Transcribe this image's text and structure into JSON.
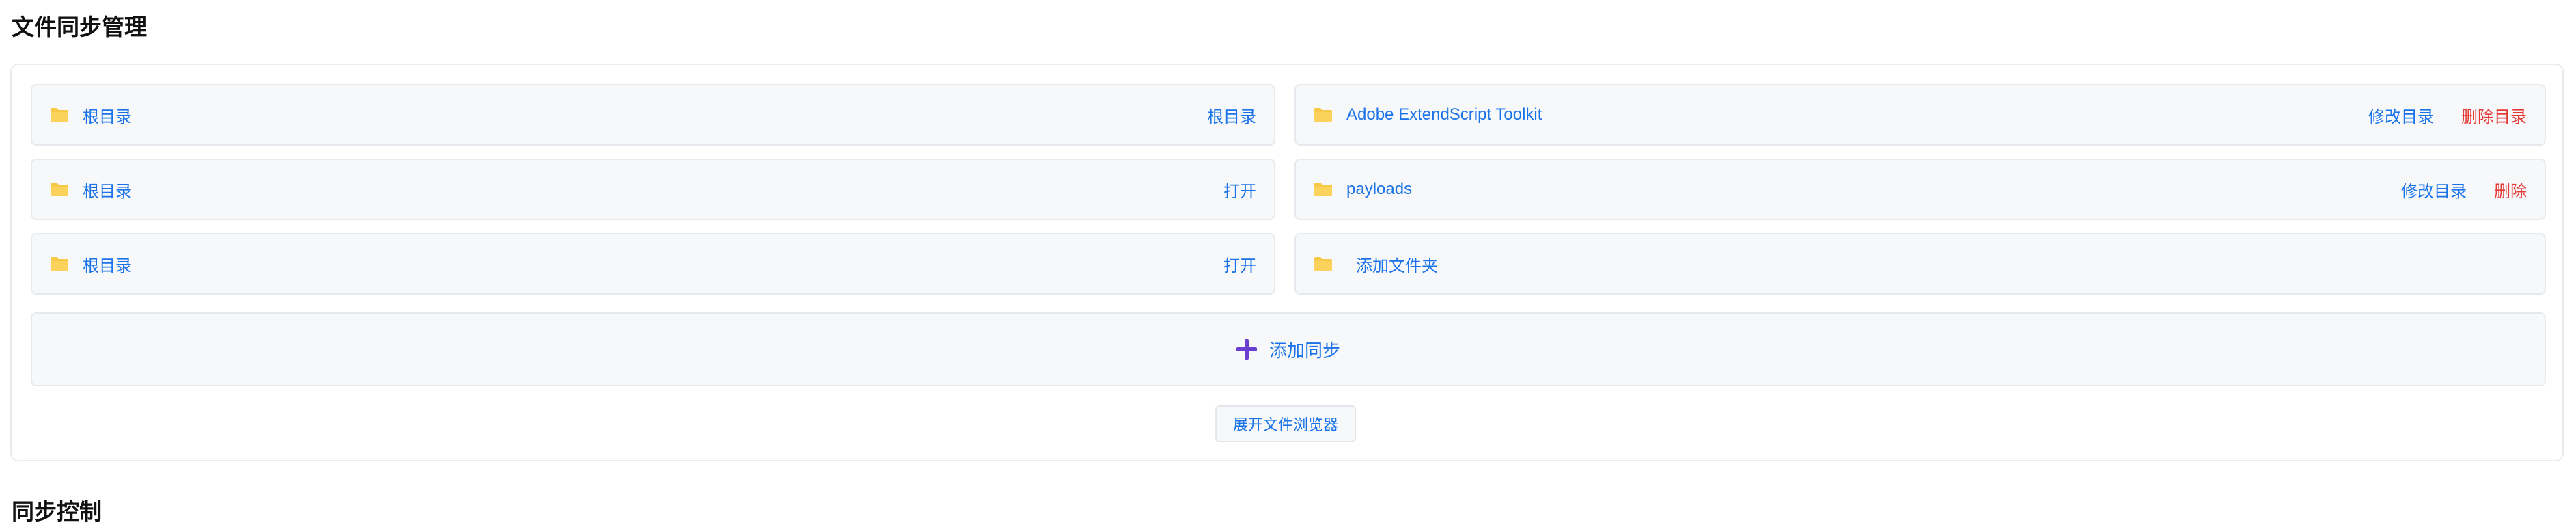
{
  "page": {
    "title": "文件同步管理",
    "next_section_title": "同步控制"
  },
  "colors": {
    "link": "#1a73e8",
    "danger": "#e53935",
    "accent_plus": "#6a3fd0",
    "folder": "#f7c948"
  },
  "sync_rows": [
    {
      "left_path": "根目录",
      "left_action": "根目录",
      "right_path": "Adobe ExtendScript Toolkit",
      "right_actions": [
        "修改目录",
        "删除目录"
      ]
    },
    {
      "left_path": "根目录",
      "left_action": "打开",
      "right_path": "payloads",
      "right_actions": [
        "修改目录",
        "删除"
      ]
    },
    {
      "left_path": "根目录",
      "left_action": "打开",
      "right_path": "添加文件夹",
      "right_actions": []
    }
  ],
  "add_sync_label": "添加同步",
  "expand_browser_label": "展开文件浏览器",
  "icons": {
    "folder": "folder-icon",
    "plus": "plus-icon"
  }
}
